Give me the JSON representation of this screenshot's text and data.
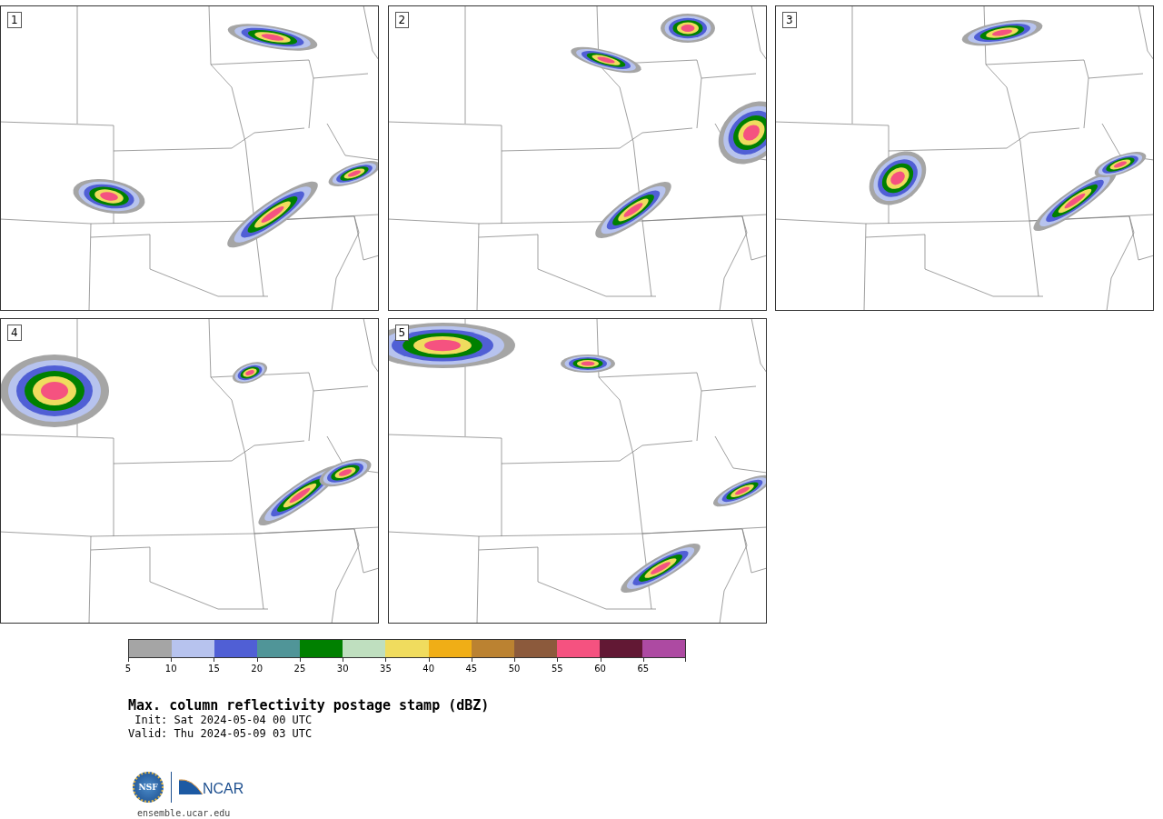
{
  "panels": [
    {
      "label": "1"
    },
    {
      "label": "2"
    },
    {
      "label": "3"
    },
    {
      "label": "4"
    },
    {
      "label": "5"
    }
  ],
  "colorbar": {
    "bins": [
      {
        "color": "#a5a5a5"
      },
      {
        "color": "#b7c3ee"
      },
      {
        "color": "#505fd5"
      },
      {
        "color": "#509598"
      },
      {
        "color": "#008000"
      },
      {
        "color": "#bfdfbf"
      },
      {
        "color": "#f0dc5e"
      },
      {
        "color": "#f0ae16"
      },
      {
        "color": "#bb8231"
      },
      {
        "color": "#8c5a3c"
      },
      {
        "color": "#f55280"
      },
      {
        "color": "#621834"
      },
      {
        "color": "#ad4aa2"
      }
    ],
    "ticks": [
      "5",
      "10",
      "15",
      "20",
      "25",
      "30",
      "35",
      "40",
      "45",
      "50",
      "55",
      "60",
      "65"
    ]
  },
  "title": "Max. column reflectivity postage stamp (dBZ)",
  "init": " Init: Sat 2024-05-04 00 UTC",
  "valid": "Valid: Thu 2024-05-09 03 UTC",
  "logos": {
    "nsf": "NSF",
    "ncar": "NCAR"
  },
  "footer": "ensemble.ucar.edu"
}
